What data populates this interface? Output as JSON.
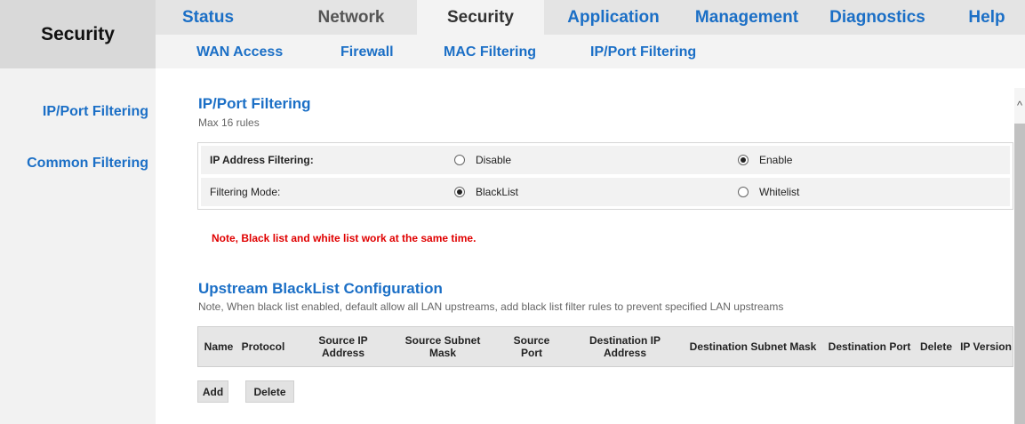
{
  "brand": {
    "title": "Security"
  },
  "topnav": {
    "items": [
      {
        "label": "Status"
      },
      {
        "label": "Network"
      },
      {
        "label": "Security"
      },
      {
        "label": "Application"
      },
      {
        "label": "Management"
      },
      {
        "label": "Diagnostics"
      },
      {
        "label": "Help"
      }
    ],
    "active": "Security"
  },
  "subnav": {
    "items": [
      {
        "label": "WAN Access"
      },
      {
        "label": "Firewall"
      },
      {
        "label": "MAC Filtering"
      },
      {
        "label": "IP/Port Filtering"
      }
    ]
  },
  "sidebar": {
    "items": [
      {
        "label": "IP/Port Filtering"
      },
      {
        "label": "Common Filtering"
      }
    ]
  },
  "main": {
    "title": "IP/Port Filtering",
    "subtitle": "Max 16 rules",
    "ip_filtering": {
      "label": "IP Address Filtering:",
      "options": [
        "Disable",
        "Enable"
      ],
      "selected": "Enable"
    },
    "filtering_mode": {
      "label": "Filtering Mode:",
      "options": [
        "BlackList",
        "Whitelist"
      ],
      "selected": "BlackList"
    },
    "warning": "Note, Black list and white list work at the same time.",
    "upstream": {
      "title": "Upstream BlackList Configuration",
      "note": "Note, When black list enabled, default allow all LAN upstreams, add black list filter rules to prevent specified LAN upstreams",
      "columns": [
        "Name",
        "Protocol",
        "Source IP Address",
        "Source Subnet Mask",
        "Source Port",
        "Destination IP Address",
        "Destination Subnet Mask",
        "Destination Port",
        "Delete",
        "IP Version"
      ],
      "rows": [],
      "add_label": "Add",
      "delete_label": "Delete"
    }
  },
  "scrollbar": {
    "up_arrow": "^"
  },
  "colors": {
    "link_blue": "#1b6fc6",
    "warning_red": "#e00000",
    "nav_bg": "#e4e4e4",
    "brand_bg": "#d9d9d9"
  }
}
